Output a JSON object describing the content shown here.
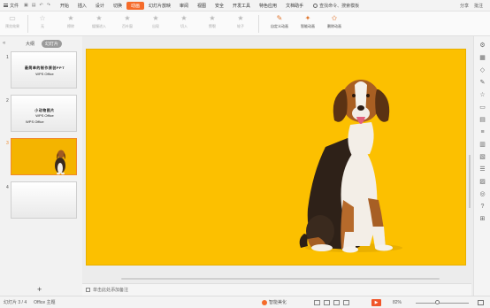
{
  "menubar": {
    "file_label": "文件",
    "tabs": [
      "开始",
      "插入",
      "设计",
      "切换",
      "动画",
      "幻灯片放映",
      "审阅",
      "视图",
      "安全",
      "开发工具",
      "特色应用",
      "文档助手"
    ],
    "active_tab": "动画",
    "search_placeholder": "查找命令、搜索模板",
    "share_label": "分享",
    "comment_label": "批注"
  },
  "ribbon": {
    "preview": "预览效果",
    "effects": [
      "无",
      "擦除",
      "缓慢进入",
      "百叶窗",
      "出现",
      "切入",
      "劈裂",
      "飞入",
      "轮子"
    ],
    "custom_animation": "自定义动画",
    "smart_animation": "智能动画",
    "delete_animation": "删除动画"
  },
  "left_panel": {
    "tab_outline": "大纲",
    "tab_slides": "幻灯片",
    "slides": [
      {
        "num": "1",
        "line1": "最简单的制作原创PPT",
        "line2": "WPS Office"
      },
      {
        "num": "2",
        "line1": "小动物图片",
        "line2": "WPS Office",
        "line3": "WPS Office"
      },
      {
        "num": "3"
      },
      {
        "num": "4"
      }
    ],
    "add_symbol": "+"
  },
  "notes": {
    "placeholder": "单击此处添加备注"
  },
  "status": {
    "slide_info": "幻灯片 3 / 4",
    "theme": "Office 主题",
    "smart_beautify": "智能美化",
    "zoom": "82%"
  },
  "colors": {
    "accent": "#f56b2a",
    "slide_bg": "#fcc000"
  }
}
